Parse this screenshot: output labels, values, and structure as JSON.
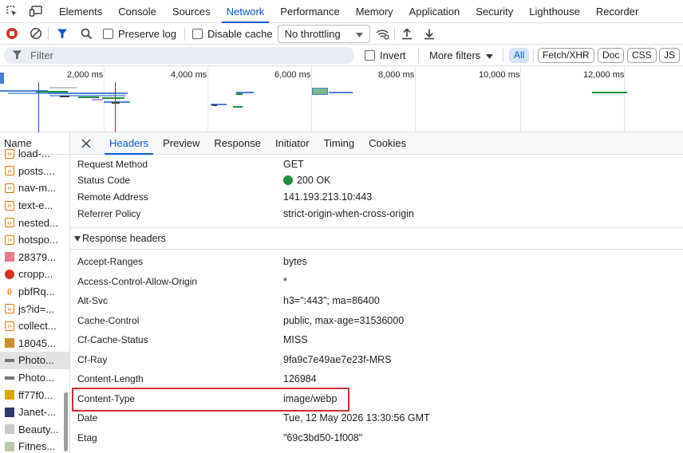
{
  "tabs": [
    "Elements",
    "Console",
    "Sources",
    "Network",
    "Performance",
    "Memory",
    "Application",
    "Security",
    "Lighthouse",
    "Recorder"
  ],
  "active_tab": "Network",
  "toolbar": {
    "preserve_log": "Preserve log",
    "disable_cache": "Disable cache",
    "throttling": "No throttling"
  },
  "filterbar": {
    "placeholder": "Filter",
    "invert": "Invert",
    "more_filters": "More filters",
    "chips": [
      "All",
      "Fetch/XHR",
      "Doc",
      "CSS",
      "JS"
    ]
  },
  "overview": {
    "ticks": [
      "2,000 ms",
      "4,000 ms",
      "6,000 ms",
      "8,000 ms",
      "10,000 ms",
      "12,000 ms"
    ]
  },
  "namecol": {
    "header": "Name",
    "rows": [
      {
        "label": "load-...",
        "icon": "script-icon"
      },
      {
        "label": "posts....",
        "icon": "script-icon"
      },
      {
        "label": "nav-m...",
        "icon": "script-icon"
      },
      {
        "label": "text-e...",
        "icon": "script-icon"
      },
      {
        "label": "nested...",
        "icon": "script-icon"
      },
      {
        "label": "hotspo...",
        "icon": "script-icon"
      },
      {
        "label": "28379...",
        "icon": "image-thumbnail-icon"
      },
      {
        "label": "cropp...",
        "icon": "image-thumbnail-icon"
      },
      {
        "label": "pbfRq...",
        "icon": "json-icon"
      },
      {
        "label": "js?id=...",
        "icon": "script-icon"
      },
      {
        "label": "collect...",
        "icon": "script-icon"
      },
      {
        "label": "18045...",
        "icon": "image-thumbnail-icon"
      },
      {
        "label": "Photo...",
        "icon": "image-thumbnail-icon"
      },
      {
        "label": "Photo...",
        "icon": "image-thumbnail-icon"
      },
      {
        "label": "ff77f0...",
        "icon": "image-thumbnail-icon"
      },
      {
        "label": "Janet-...",
        "icon": "image-thumbnail-icon"
      },
      {
        "label": "Beauty...",
        "icon": "image-thumbnail-icon"
      },
      {
        "label": "Fitnes...",
        "icon": "image-thumbnail-icon"
      }
    ]
  },
  "details": {
    "tabs": [
      "Headers",
      "Preview",
      "Response",
      "Initiator",
      "Timing",
      "Cookies"
    ],
    "active_tab": "Headers",
    "general": [
      {
        "key": "Request Method",
        "value": "GET"
      },
      {
        "key": "Status Code",
        "value": "200 OK"
      },
      {
        "key": "Remote Address",
        "value": "141.193.213.10:443"
      },
      {
        "key": "Referrer Policy",
        "value": "strict-origin-when-cross-origin"
      }
    ],
    "response_section": "Response headers",
    "response_headers": [
      {
        "key": "Accept-Ranges",
        "value": "bytes"
      },
      {
        "key": "Access-Control-Allow-Origin",
        "value": "*"
      },
      {
        "key": "Alt-Svc",
        "value": "h3=\":443\"; ma=86400"
      },
      {
        "key": "Cache-Control",
        "value": "public, max-age=31536000"
      },
      {
        "key": "Cf-Cache-Status",
        "value": "MISS"
      },
      {
        "key": "Cf-Ray",
        "value": "9fa9c7e49ae7e23f-MRS"
      },
      {
        "key": "Content-Length",
        "value": "126984"
      },
      {
        "key": "Content-Type",
        "value": "image/webp"
      },
      {
        "key": "Date",
        "value": "Tue, 12 May 2026 13:30:56 GMT"
      },
      {
        "key": "Etag",
        "value": "\"69c3bd50-1f008\""
      }
    ]
  },
  "colors": {
    "accent": "#0b57d0",
    "highlight_box": "#d32f2f",
    "status_ok": "#1e8e3e",
    "record_button": "#d93025"
  }
}
